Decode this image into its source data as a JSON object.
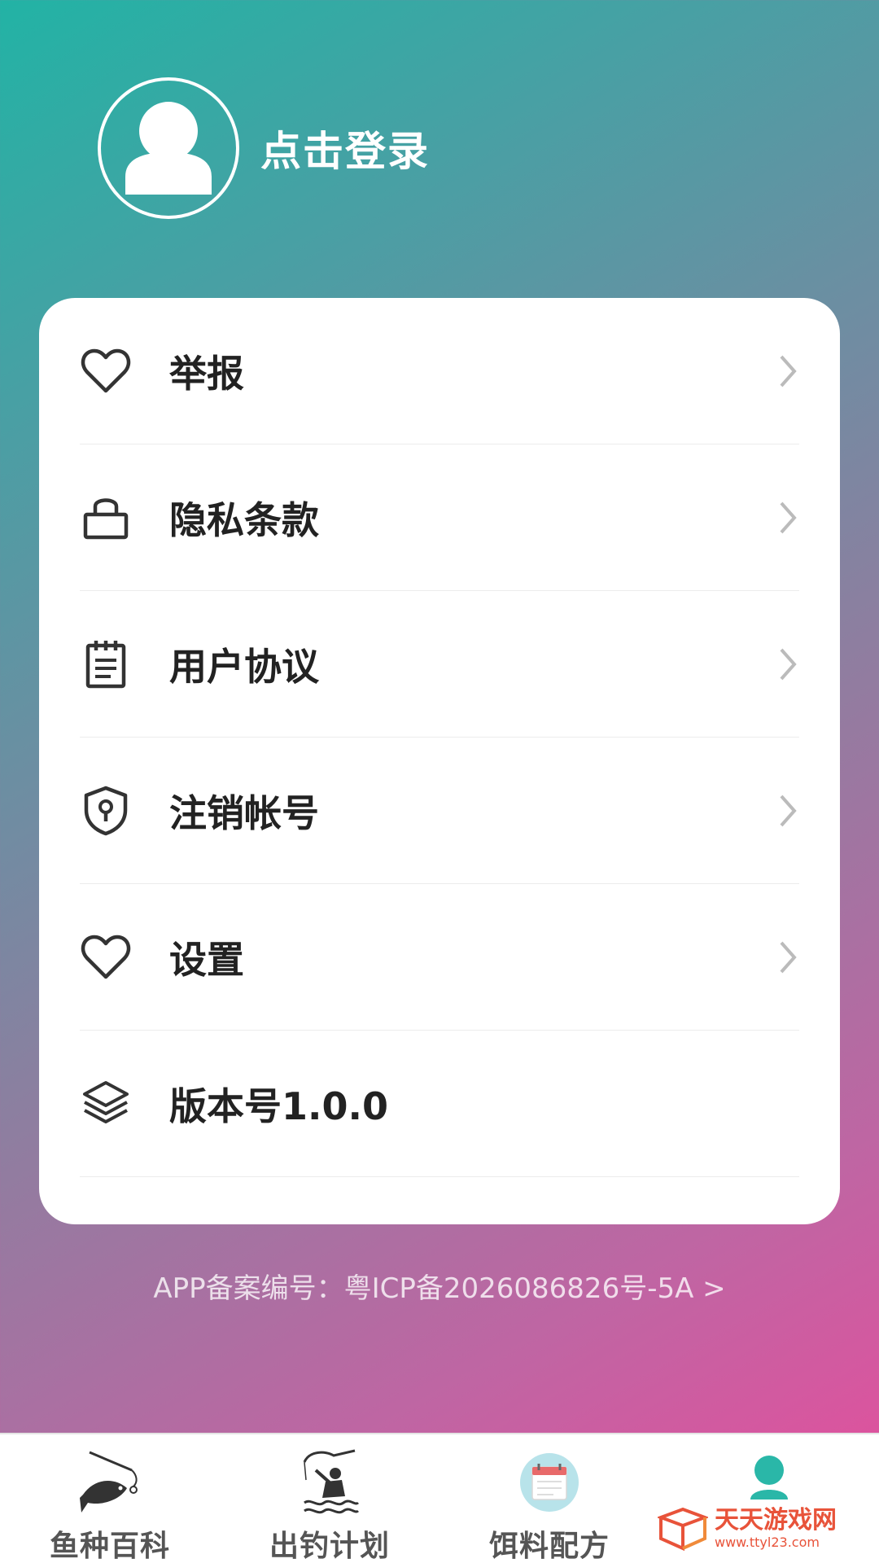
{
  "profile": {
    "login_label": "点击登录"
  },
  "menu": {
    "items": [
      {
        "label": "举报",
        "icon": "heart-outline-icon"
      },
      {
        "label": "隐私条款",
        "icon": "lock-icon"
      },
      {
        "label": "用户协议",
        "icon": "notepad-icon"
      },
      {
        "label": "注销帐号",
        "icon": "shield-keyhole-icon"
      },
      {
        "label": "设置",
        "icon": "heart-outline-icon"
      },
      {
        "label": "版本号1.0.0",
        "icon": "layers-icon"
      }
    ]
  },
  "footer": {
    "icp": "APP备案编号：粤ICP备2026086826号-5A >"
  },
  "tabbar": {
    "tabs": [
      {
        "label": "鱼种百科",
        "icon": "fish-catch-icon"
      },
      {
        "label": "出钓计划",
        "icon": "fisherman-icon"
      },
      {
        "label": "饵料配方",
        "icon": "calendar-icon"
      },
      {
        "label": "",
        "icon": "user-icon",
        "active": true
      }
    ]
  },
  "watermark": {
    "main": "天天游戏网",
    "url": "www.ttyl23.com"
  },
  "colors": {
    "gradient_start": "#22b3a5",
    "gradient_end": "#e84c9c",
    "active_tab": "#2ab7a8"
  }
}
